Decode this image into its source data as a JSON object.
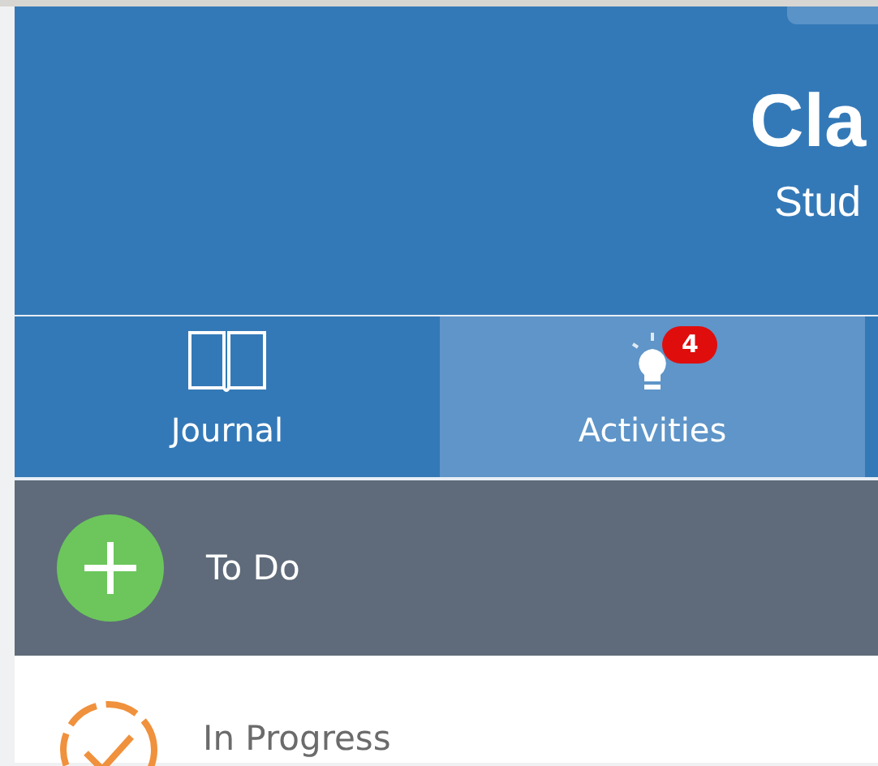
{
  "header": {
    "title": "Cla",
    "subtitle": "Stud"
  },
  "tabs": [
    {
      "label": "Journal",
      "kind": "book",
      "selected": false
    },
    {
      "label": "Activities",
      "kind": "bulb",
      "selected": true,
      "badge": "4"
    }
  ],
  "statuses": [
    {
      "label": "To Do",
      "kind": "todo",
      "selected": true
    },
    {
      "label": "In Progress",
      "kind": "in_progress",
      "selected": false
    }
  ]
}
